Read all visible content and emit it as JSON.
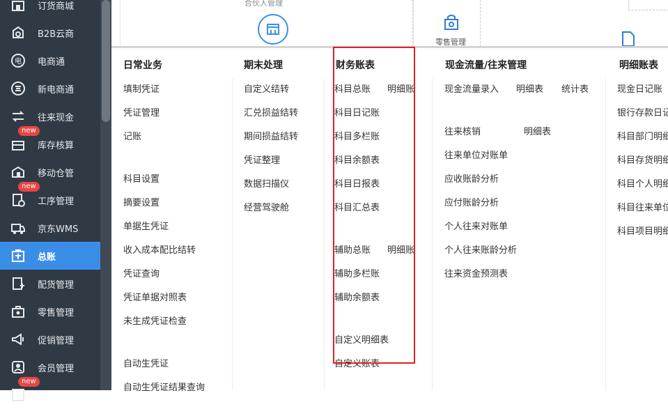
{
  "sidebar": {
    "items": [
      {
        "label": "订货商城",
        "icon": "store-icon"
      },
      {
        "label": "B2B云商",
        "icon": "cloud-shop-icon"
      },
      {
        "label": "电商通",
        "icon": "ecommerce-icon"
      },
      {
        "label": "新电商通",
        "icon": "new-ecommerce-icon"
      },
      {
        "label": "往来现金",
        "icon": "exchange-icon"
      },
      {
        "label": "库存核算",
        "icon": "inventory-icon",
        "badge": "new"
      },
      {
        "label": "移动仓管",
        "icon": "mobile-warehouse-icon"
      },
      {
        "label": "工序管理",
        "icon": "process-icon",
        "badge": "new"
      },
      {
        "label": "京东WMS",
        "icon": "truck-icon"
      },
      {
        "label": "总账",
        "icon": "ledger-icon",
        "active": true
      },
      {
        "label": "配货管理",
        "icon": "distribution-icon"
      },
      {
        "label": "零售管理",
        "icon": "retail-icon"
      },
      {
        "label": "促销管理",
        "icon": "megaphone-icon"
      },
      {
        "label": "会员管理",
        "icon": "member-icon"
      },
      {
        "label": "",
        "icon": "more-icon",
        "badge": "new"
      }
    ]
  },
  "top": {
    "partner_label": "合伙人管理",
    "retail_label": "零售管理"
  },
  "columns": {
    "daily": {
      "title": "日常业务",
      "items": [
        "填制凭证",
        "凭证管理",
        "记账",
        "科目设置",
        "摘要设置",
        "单据生凭证",
        "收入成本配比结转",
        "凭证查询",
        "凭证单据对照表",
        "未生成凭证检查",
        "自动生凭证",
        "自动生凭证结果查询"
      ]
    },
    "period": {
      "title": "期末处理",
      "items": [
        "自定义结转",
        "汇兑损益结转",
        "期间损益结转",
        "凭证整理",
        "数据扫描仪",
        "经营驾驶舱"
      ]
    },
    "finance": {
      "title": "财务账表",
      "items": [
        "科目总账",
        "明细账",
        "科目日记账",
        "科目多栏账",
        "科目余额表",
        "科目日报表",
        "科目汇总表",
        "辅助总账",
        "明细账",
        "辅助多栏账",
        "辅助余额表",
        "自定义明细表",
        "自定义账表"
      ]
    },
    "cashflow": {
      "title": "现金流量/往来管理",
      "items": [
        "现金流量录入",
        "明细表",
        "统计表",
        "往来核销",
        "明细表",
        "往来单位对账单",
        "应收账龄分析",
        "应付账龄分析",
        "个人往来对账单",
        "个人往来账龄分析",
        "往来资金预测表"
      ]
    },
    "detail": {
      "title": "明细账表",
      "items": [
        "现金日记账",
        "银行存款日记",
        "科目部门明细",
        "科目存货明细",
        "科目个人明细",
        "科目往来单位",
        "科目项目明细"
      ]
    }
  }
}
